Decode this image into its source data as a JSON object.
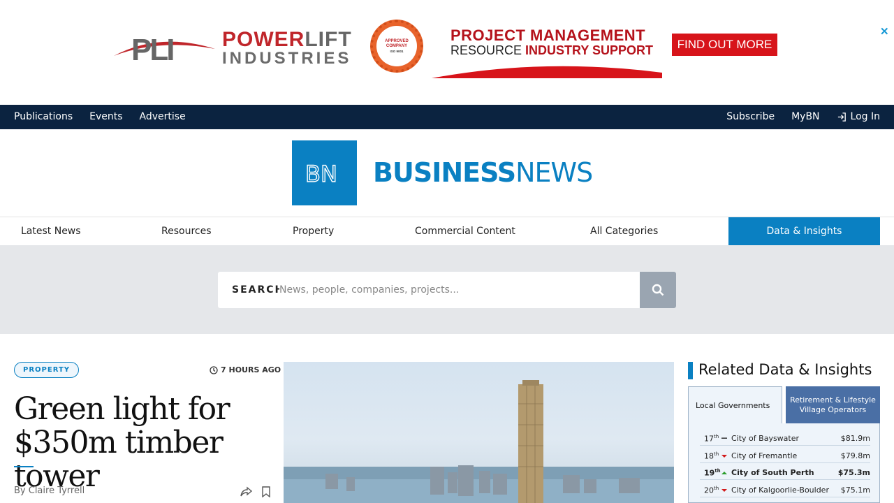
{
  "ad": {
    "brand_line1_red": "POWER",
    "brand_line1_grey": "LIFT",
    "brand_line2": "INDUSTRIES",
    "badge_line1": "APPROVED",
    "badge_line2": "COMPANY",
    "badge_line3": "ISO 9001",
    "headline": "PROJECT MANAGEMENT",
    "subline_plain": "RESOURCE ",
    "subline_bold": "INDUSTRY SUPPORT",
    "cta": "FIND OUT MORE",
    "close": "✕"
  },
  "topnav": {
    "left": [
      "Publications",
      "Events",
      "Advertise"
    ],
    "subscribe": "Subscribe",
    "mybn": "MyBN",
    "login": "Log In"
  },
  "logo": {
    "mark": "BN",
    "word_bold": "BUSINESS",
    "word_thin": "NEWS"
  },
  "mainnav": {
    "items": [
      "Latest News",
      "Resources",
      "Property",
      "Commercial Content",
      "All Categories"
    ],
    "highlight": "Data & Insights"
  },
  "search": {
    "label": "SEARCH",
    "placeholder": "News, people, companies, projects..."
  },
  "article": {
    "tag": "PROPERTY",
    "time": "7 HOURS AGO",
    "headline": "Green light for $350m timber tower",
    "byline": "By Claire Tyrrell"
  },
  "sidebar": {
    "title": "Related Data & Insights",
    "tab_active": "Local Governments",
    "tab_other": "Retirement & Lifestyle Village Operators",
    "rows": [
      {
        "rank": "17",
        "suffix": "th",
        "trend": "flat",
        "name": "City of Bayswater",
        "value": "$81.9m"
      },
      {
        "rank": "18",
        "suffix": "th",
        "trend": "down",
        "name": "City of Fremantle",
        "value": "$79.8m"
      },
      {
        "rank": "19",
        "suffix": "th",
        "trend": "up",
        "name": "City of South Perth",
        "value": "$75.3m"
      },
      {
        "rank": "20",
        "suffix": "th",
        "trend": "down",
        "name": "City of Kalgoorlie-Boulder",
        "value": "$75.1m"
      }
    ]
  },
  "colors": {
    "navy": "#0b2340",
    "brand_blue": "#0a80c2",
    "trend_up": "#2a9d2a",
    "trend_down": "#d11a1a"
  }
}
